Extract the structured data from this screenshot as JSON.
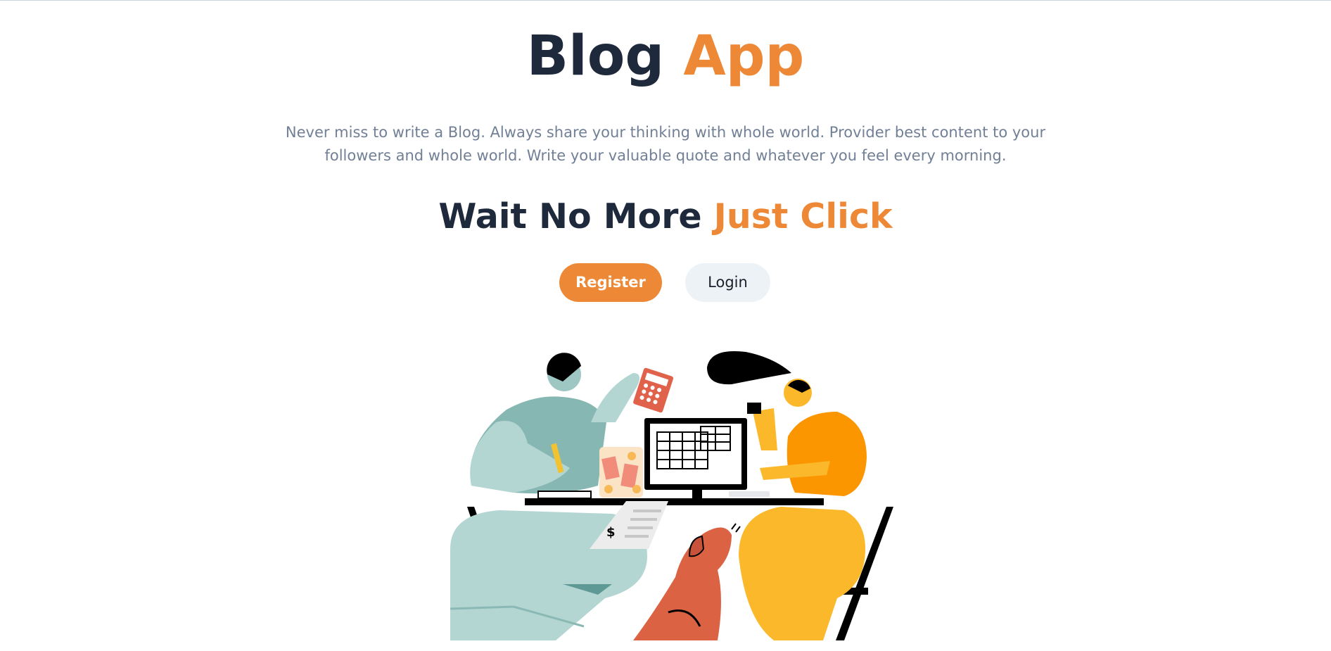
{
  "hero": {
    "title_main": "Blog",
    "title_accent": "App",
    "description": "Never miss to write a Blog. Always share your thinking with whole world. Provider best content to your followers and whole world. Write your valuable quote and whatever you feel every morning.",
    "cta_main": "Wait No More",
    "cta_accent": "Just Click"
  },
  "actions": {
    "register_label": "Register",
    "login_label": "Login"
  },
  "illustration": {
    "name": "people-working-at-desk-illustration",
    "receipt_symbol": "$"
  },
  "colors": {
    "accent": "#ed8936",
    "heading": "#1e293b",
    "body_text": "#718096",
    "login_bg": "#edf2f7"
  }
}
